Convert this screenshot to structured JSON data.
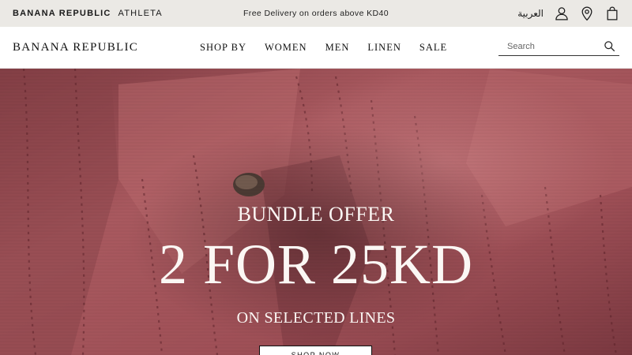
{
  "topbar": {
    "brands": [
      {
        "label": "BANANA REPUBLIC",
        "active": true
      },
      {
        "label": "ATHLETA",
        "active": false
      }
    ],
    "promo_text": "Free Delivery on orders above KD40",
    "language_label": "العربية",
    "icons": [
      "account-icon",
      "store-locator-icon",
      "shopping-bag-icon"
    ]
  },
  "header": {
    "logo_text": "BANANA REPUBLIC",
    "nav_items": [
      "SHOP BY",
      "WOMEN",
      "MEN",
      "LINEN",
      "SALE"
    ],
    "search": {
      "placeholder": "Search",
      "value": ""
    }
  },
  "hero": {
    "kicker": "BUNDLE OFFER",
    "headline": "2 FOR 25KD",
    "subline": "ON SELECTED LINES",
    "cta_label": "SHOP NOW"
  },
  "colors": {
    "topbar_bg": "#ebe9e5",
    "hero_fabric": "#a2565c",
    "hero_text": "#fbf7f4"
  }
}
